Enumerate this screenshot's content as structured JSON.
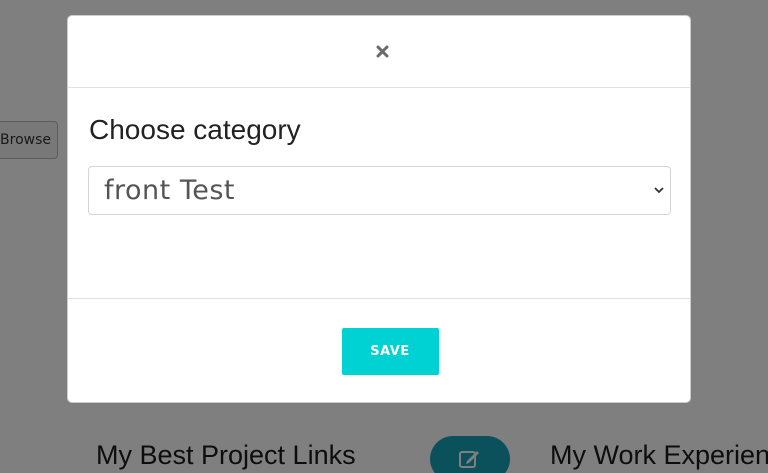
{
  "background": {
    "browse_label": "Browse",
    "left_heading": "My Best Project Links",
    "right_heading": "My Work Experien"
  },
  "modal": {
    "close_glyph": "×",
    "title": "Choose category",
    "select": {
      "selected_value": "front Test"
    },
    "save_label": "SAVE"
  },
  "colors": {
    "save_button": "#00d2d3",
    "edit_button": "#17a2b8",
    "backdrop": "rgba(0,0,0,0.5)"
  },
  "icons": {
    "close": "close-icon",
    "chevron": "chevron-down-icon",
    "edit": "edit-icon"
  }
}
